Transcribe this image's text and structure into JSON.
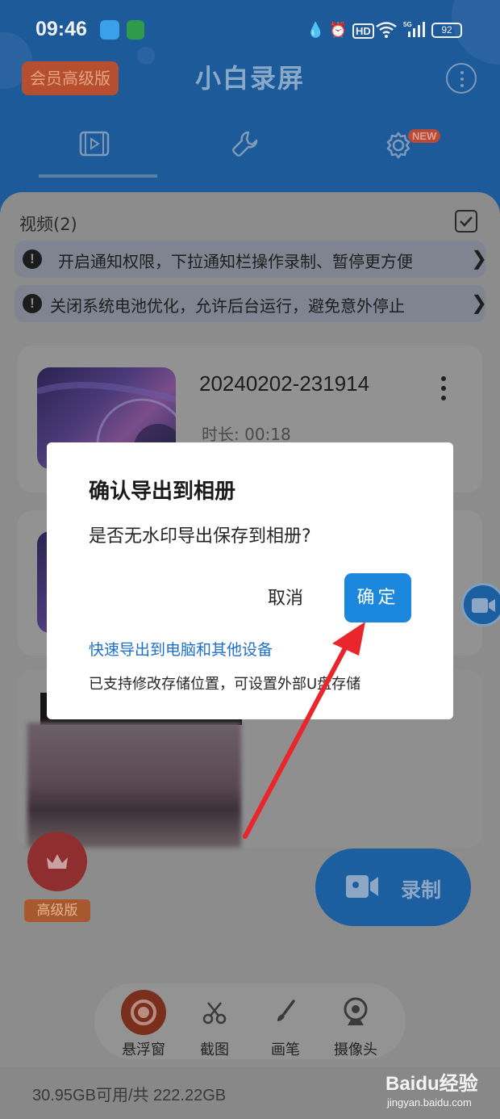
{
  "status_bar": {
    "time": "09:46",
    "battery": "92",
    "icons": [
      "app-icon",
      "shield-app-icon",
      "droplet-icon",
      "alarm-icon",
      "hd-icon",
      "wifi-icon",
      "5g-signal-icon",
      "battery-icon"
    ]
  },
  "header": {
    "vip_badge": "会员高级版",
    "title": "小白录屏",
    "tabs": [
      {
        "name": "videos",
        "icon": "video-icon"
      },
      {
        "name": "tools",
        "icon": "wrench-icon"
      },
      {
        "name": "settings",
        "icon": "gear-icon",
        "badge": "NEW"
      }
    ]
  },
  "list": {
    "section_title": "视频(2)",
    "notices": [
      {
        "text": "开启通知权限，下拉通知栏操作录制、暂停更方便"
      },
      {
        "text": "关闭系统电池优化，允许后台运行，避免意外停止"
      }
    ],
    "videos": [
      {
        "name": "20240202-231914",
        "duration": "时长: 00:18"
      }
    ]
  },
  "dialog": {
    "title": "确认导出到相册",
    "message": "是否无水印导出保存到相册?",
    "cancel_label": "取消",
    "confirm_label": "确定",
    "link_text": "快速导出到电脑和其他设备",
    "note_text": "已支持修改存储位置，可设置外部U盘存储"
  },
  "actions": {
    "pro_label": "高级版",
    "record_label": "录制"
  },
  "toolbar": {
    "items": [
      {
        "label": "悬浮窗",
        "icon": "floating-window-icon"
      },
      {
        "label": "截图",
        "icon": "scissors-icon"
      },
      {
        "label": "画笔",
        "icon": "brush-icon"
      },
      {
        "label": "摄像头",
        "icon": "webcam-icon"
      }
    ]
  },
  "footer": {
    "storage": "30.95GB可用/共 222.22GB",
    "watermark_text": "Baidu经验",
    "watermark_url": "jingyan.baidu.com"
  },
  "colors": {
    "header_blue": "#1d5a9a",
    "confirm_blue": "#1b88dd",
    "link_blue": "#1e6fc8",
    "annotation_arrow": "#e8262c"
  }
}
